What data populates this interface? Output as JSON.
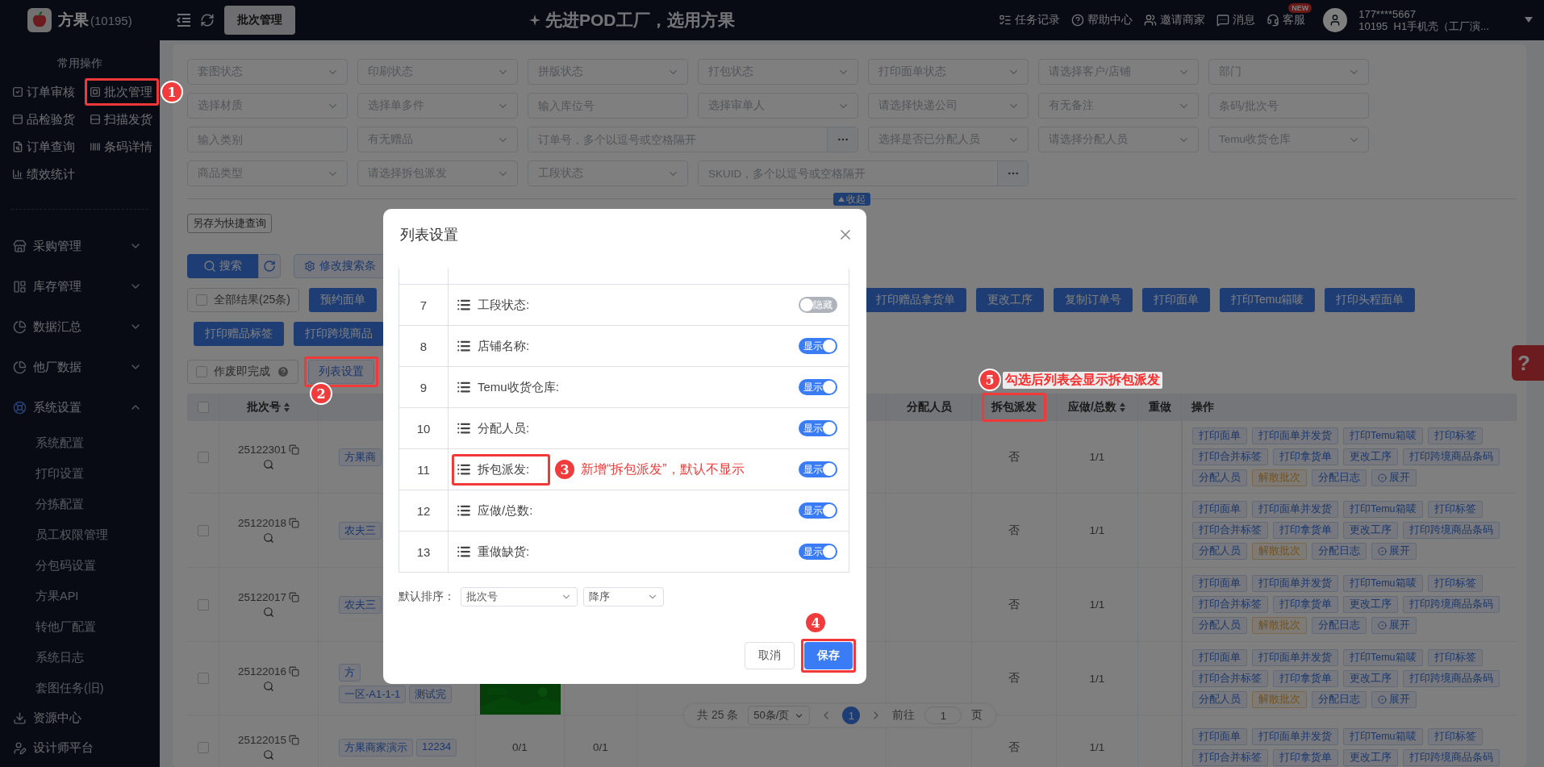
{
  "sidebar": {
    "brand": "方果",
    "brand_count": "(10195)",
    "quick_title": "常用操作",
    "quick_ops": [
      {
        "label": "订单审核"
      },
      {
        "label": "批次管理",
        "annotation": "1"
      },
      {
        "label": "品检验货"
      },
      {
        "label": "扫描发货"
      },
      {
        "label": "订单查询"
      },
      {
        "label": "条码详情"
      },
      {
        "label": "绩效统计"
      }
    ],
    "menu": [
      {
        "label": "采购管理",
        "expanded": false
      },
      {
        "label": "库存管理",
        "expanded": false
      },
      {
        "label": "数据汇总",
        "expanded": false
      },
      {
        "label": "他厂数据",
        "expanded": false
      },
      {
        "label": "系统设置",
        "expanded": true,
        "children": [
          {
            "label": "系统配置"
          },
          {
            "label": "打印设置"
          },
          {
            "label": "分拣配置"
          },
          {
            "label": "员工权限管理"
          },
          {
            "label": "分包码设置"
          },
          {
            "label": "方果API"
          },
          {
            "label": "转他厂配置"
          },
          {
            "label": "系统日志"
          },
          {
            "label": "套图任务(旧)"
          }
        ]
      },
      {
        "label": "资源中心"
      },
      {
        "label": "设计师平台"
      }
    ]
  },
  "topbar": {
    "tab": "批次管理",
    "slogan": "先进POD工厂，选用方果",
    "links": [
      {
        "label": "任务记录"
      },
      {
        "label": "帮助中心"
      },
      {
        "label": "邀请商家"
      },
      {
        "label": "消息"
      },
      {
        "label": "客服",
        "badge": "NEW"
      }
    ],
    "user": {
      "phone": "177****5667",
      "org": "10195  H1手机壳（工厂演..."
    }
  },
  "filters": [
    [
      {
        "kind": "select",
        "placeholder": "套图状态"
      },
      {
        "kind": "select",
        "placeholder": "印刷状态"
      },
      {
        "kind": "select",
        "placeholder": "拼版状态"
      },
      {
        "kind": "select",
        "placeholder": "打包状态"
      },
      {
        "kind": "select",
        "placeholder": "打印面单状态"
      },
      {
        "kind": "select",
        "placeholder": "请选择客户/店铺"
      },
      {
        "kind": "select",
        "placeholder": "部门"
      }
    ],
    [
      {
        "kind": "select",
        "placeholder": "选择材质"
      },
      {
        "kind": "select",
        "placeholder": "选择单多件"
      },
      {
        "kind": "input",
        "placeholder": "输入库位号"
      },
      {
        "kind": "select",
        "placeholder": "选择审单人"
      },
      {
        "kind": "select",
        "placeholder": "请选择快递公司"
      },
      {
        "kind": "select",
        "placeholder": "有无备注"
      },
      {
        "kind": "input",
        "placeholder": "条码/批次号"
      }
    ],
    [
      {
        "kind": "input",
        "placeholder": "输入类别"
      },
      {
        "kind": "select",
        "placeholder": "有无赠品"
      },
      {
        "kind": "multi",
        "placeholder": "订单号，多个以逗号或空格隔开"
      },
      {
        "kind": "select",
        "placeholder": "选择是否已分配人员"
      },
      {
        "kind": "select",
        "placeholder": "请选择分配人员"
      },
      {
        "kind": "select",
        "placeholder": "Temu收货仓库"
      }
    ],
    [
      {
        "kind": "select",
        "placeholder": "商品类型"
      },
      {
        "kind": "select",
        "placeholder": "请选择拆包派发"
      },
      {
        "kind": "select",
        "placeholder": "工段状态"
      },
      {
        "kind": "multi",
        "placeholder": "SKUID，多个以逗号或空格隔开"
      }
    ]
  ],
  "collapse": "收起",
  "save_query": "另存为快捷查询",
  "search": "搜索",
  "modify_conditions": "修改搜索条",
  "toolbar": {
    "all_results": {
      "label": "全部结果(25条)",
      "checked": false
    },
    "row1_left": [
      "预约面单"
    ],
    "row1_right": [
      "打印赠品拿货单",
      "更改工序",
      "复制订单号",
      "打印面单",
      "打印Temu箱唛",
      "打印头程面单"
    ],
    "row2": [
      "打印赠品标签",
      "打印跨境商品"
    ],
    "void_done": {
      "label": "作废即完成",
      "checked": false
    },
    "list_settings": {
      "label": "列表设置",
      "annotation": "2"
    }
  },
  "table": {
    "header_checked": false,
    "columns": [
      {
        "kind": "batch",
        "label": "批次号",
        "sortable": true
      },
      {
        "kind": "assignee",
        "label": "分配人员"
      },
      {
        "kind": "unpack",
        "label": "拆包派发",
        "annotation": "5",
        "note": "勾选后列表会显示拆包派发"
      },
      {
        "kind": "ratio",
        "label": "应做/总数",
        "sortable": true
      },
      {
        "kind": "redo",
        "label": "重做"
      },
      {
        "kind": "ops",
        "label": "操作"
      }
    ],
    "rows": [
      {
        "batch": "25122301",
        "checked": false,
        "tag_lines": [
          [
            "方果商"
          ]
        ],
        "unpack": "否",
        "ratio": "1/1",
        "op_lines": [
          [
            {
              "label": "打印面单",
              "kind": "normal"
            },
            {
              "label": "打印面单并发货",
              "kind": "normal"
            },
            {
              "label": "打印Temu箱唛",
              "kind": "normal"
            },
            {
              "label": "打印标签",
              "kind": "normal"
            }
          ],
          [
            {
              "label": "打印合并标签",
              "kind": "normal"
            },
            {
              "label": "打印拿货单",
              "kind": "normal"
            },
            {
              "label": "更改工序",
              "kind": "normal"
            },
            {
              "label": "打印跨境商品条码",
              "kind": "normal"
            }
          ],
          [
            {
              "label": "分配人员",
              "kind": "normal"
            },
            {
              "label": "解散批次",
              "kind": "warn"
            },
            {
              "label": "分配日志",
              "kind": "normal"
            },
            {
              "label": "展开",
              "kind": "expand"
            }
          ]
        ]
      },
      {
        "batch": "25122018",
        "checked": false,
        "tag_lines": [
          [
            "农夫三"
          ]
        ],
        "unpack": "否",
        "ratio": "1/1",
        "op_lines": [
          [
            {
              "label": "打印面单",
              "kind": "normal"
            },
            {
              "label": "打印面单并发货",
              "kind": "normal"
            },
            {
              "label": "打印Temu箱唛",
              "kind": "normal"
            },
            {
              "label": "打印标签",
              "kind": "normal"
            }
          ],
          [
            {
              "label": "打印合并标签",
              "kind": "normal"
            },
            {
              "label": "打印拿货单",
              "kind": "normal"
            },
            {
              "label": "更改工序",
              "kind": "normal"
            },
            {
              "label": "打印跨境商品条码",
              "kind": "normal"
            }
          ],
          [
            {
              "label": "分配人员",
              "kind": "normal"
            },
            {
              "label": "解散批次",
              "kind": "warn"
            },
            {
              "label": "分配日志",
              "kind": "normal"
            },
            {
              "label": "展开",
              "kind": "expand"
            }
          ]
        ]
      },
      {
        "batch": "25122017",
        "checked": false,
        "tag_lines": [
          [
            "农夫三"
          ]
        ],
        "unpack": "否",
        "ratio": "1/1",
        "op_lines": [
          [
            {
              "label": "打印面单",
              "kind": "normal"
            },
            {
              "label": "打印面单并发货",
              "kind": "normal"
            },
            {
              "label": "打印Temu箱唛",
              "kind": "normal"
            },
            {
              "label": "打印标签",
              "kind": "normal"
            }
          ],
          [
            {
              "label": "打印合并标签",
              "kind": "normal"
            },
            {
              "label": "打印拿货单",
              "kind": "normal"
            },
            {
              "label": "更改工序",
              "kind": "normal"
            },
            {
              "label": "打印跨境商品条码",
              "kind": "normal"
            }
          ],
          [
            {
              "label": "分配人员",
              "kind": "normal"
            },
            {
              "label": "解散批次",
              "kind": "warn"
            },
            {
              "label": "分配日志",
              "kind": "normal"
            },
            {
              "label": "展开",
              "kind": "expand"
            }
          ]
        ]
      },
      {
        "batch": "25122016",
        "checked": false,
        "tag_lines": [
          [
            "方"
          ],
          [
            "一区-A1-1-1",
            "测试完"
          ]
        ],
        "thumb": {
          "kind": "picture"
        },
        "unpack": "否",
        "ratio": "1/1",
        "op_lines": [
          [
            {
              "label": "打印面单",
              "kind": "normal"
            },
            {
              "label": "打印面单并发货",
              "kind": "normal"
            },
            {
              "label": "打印Temu箱唛",
              "kind": "normal"
            },
            {
              "label": "打印标签",
              "kind": "normal"
            }
          ],
          [
            {
              "label": "打印合并标签",
              "kind": "normal"
            },
            {
              "label": "打印拿货单",
              "kind": "normal"
            },
            {
              "label": "更改工序",
              "kind": "normal"
            },
            {
              "label": "打印跨境商品条码",
              "kind": "normal"
            }
          ],
          [
            {
              "label": "分配人员",
              "kind": "normal"
            },
            {
              "label": "解散批次",
              "kind": "warn"
            },
            {
              "label": "分配日志",
              "kind": "normal"
            },
            {
              "label": "展开",
              "kind": "expand"
            }
          ]
        ]
      },
      {
        "batch": "25122015",
        "checked": false,
        "tag_lines": [
          [
            "方果商家演示",
            "12234"
          ]
        ],
        "col_4": "0/1",
        "col_5": "0/1",
        "unpack": "否",
        "ratio": "1/1",
        "op_lines": [
          [
            {
              "label": "打印面单",
              "kind": "normal"
            },
            {
              "label": "打印面单并发货",
              "kind": "normal"
            },
            {
              "label": "打印Temu箱唛",
              "kind": "normal"
            },
            {
              "label": "打印标签",
              "kind": "normal"
            }
          ],
          [
            {
              "label": "打印合并标签",
              "kind": "normal"
            },
            {
              "label": "打印拿货单",
              "kind": "normal"
            },
            {
              "label": "更改工序",
              "kind": "normal"
            },
            {
              "label": "打印跨境商品条码",
              "kind": "normal"
            }
          ]
        ]
      }
    ]
  },
  "pagination": {
    "total": "共 25 条",
    "page_size": "50条/页",
    "pages": [
      {
        "label": "1",
        "selected": true
      }
    ],
    "goto": "前往",
    "goto_value": "1",
    "page_unit": "页"
  },
  "help_tab": "?",
  "modal": {
    "title": "列表设置",
    "rows": [
      {
        "index": "7",
        "label": "工段状态:",
        "on": false,
        "state_text": "隐藏"
      },
      {
        "index": "8",
        "label": "店铺名称:",
        "on": true,
        "state_text": "显示"
      },
      {
        "index": "9",
        "label": "Temu收货仓库:",
        "on": true,
        "state_text": "显示"
      },
      {
        "index": "10",
        "label": "分配人员:",
        "on": true,
        "state_text": "显示"
      },
      {
        "index": "11",
        "label": "拆包派发:",
        "on": true,
        "state_text": "显示",
        "annotation": "3",
        "note": "新增“拆包派发”，默认不显示"
      },
      {
        "index": "12",
        "label": "应做/总数:",
        "on": true,
        "state_text": "显示"
      },
      {
        "index": "13",
        "label": "重做缺货:",
        "on": true,
        "state_text": "显示"
      }
    ],
    "sort_label": "默认排序：",
    "sort_field": "批次号",
    "sort_order": "降序",
    "cancel": "取消",
    "save": {
      "label": "保存",
      "annotation": "4"
    }
  }
}
